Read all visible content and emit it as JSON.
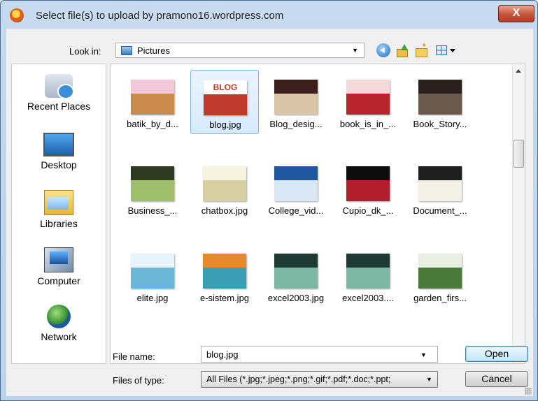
{
  "window": {
    "title": "Select file(s) to upload by pramono16.wordpress.com",
    "close_glyph": "X"
  },
  "lookin": {
    "label": "Look in:",
    "value": "Pictures"
  },
  "toolbar": {
    "icons": [
      "back-icon",
      "up-folder-icon",
      "new-folder-icon",
      "view-menu-icon"
    ]
  },
  "places": [
    {
      "label": "Recent Places",
      "icon": "recent-places-icon"
    },
    {
      "label": "Desktop",
      "icon": "desktop-icon"
    },
    {
      "label": "Libraries",
      "icon": "libraries-icon"
    },
    {
      "label": "Computer",
      "icon": "computer-icon"
    },
    {
      "label": "Network",
      "icon": "network-icon"
    }
  ],
  "files": [
    {
      "name": "batik_by_d...",
      "thumb_colors": [
        "#f3c9d9",
        "#c98a4a"
      ]
    },
    {
      "name": "blog.jpg",
      "thumb_text": "BLOG",
      "selected": true,
      "thumb_colors": [
        "#ffffff",
        "#c0392b"
      ]
    },
    {
      "name": "Blog_desig...",
      "thumb_colors": [
        "#3a1f1a",
        "#d9c4a8"
      ]
    },
    {
      "name": "book_is_in_...",
      "thumb_colors": [
        "#f4d9d9",
        "#b8242c"
      ]
    },
    {
      "name": "Book_Story...",
      "thumb_colors": [
        "#2a211c",
        "#6b5a4c"
      ]
    },
    {
      "name": "Business_...",
      "thumb_colors": [
        "#2f3a22",
        "#9fbf6a"
      ]
    },
    {
      "name": "chatbox.jpg",
      "thumb_colors": [
        "#f7f3de",
        "#d8cfa0"
      ]
    },
    {
      "name": "College_vid...",
      "thumb_colors": [
        "#1f57a0",
        "#d9e6f3"
      ]
    },
    {
      "name": "Cupio_dk_...",
      "thumb_colors": [
        "#0c0c0c",
        "#b21e2c"
      ]
    },
    {
      "name": "Document_...",
      "thumb_colors": [
        "#1e1e1e",
        "#f3f0e6"
      ]
    },
    {
      "name": "elite.jpg",
      "thumb_colors": [
        "#e6f4fb",
        "#6ab7d9"
      ]
    },
    {
      "name": "e-sistem.jpg",
      "thumb_colors": [
        "#e78a2f",
        "#3b9fb3"
      ]
    },
    {
      "name": "excel2003.jpg",
      "thumb_colors": [
        "#1e3a33",
        "#7cb8a3"
      ]
    },
    {
      "name": "excel2003....",
      "thumb_colors": [
        "#1e3a33",
        "#7cb8a3"
      ]
    },
    {
      "name": "garden_firs...",
      "thumb_colors": [
        "#e9efe3",
        "#4a7a3a"
      ]
    }
  ],
  "filename": {
    "label": "File name:",
    "value": "blog.jpg"
  },
  "filetype": {
    "label": "Files of type:",
    "value": "All Files (*.jpg;*.jpeg;*.png;*.gif;*.pdf;*.doc;*.ppt;"
  },
  "buttons": {
    "open": "Open",
    "cancel": "Cancel"
  }
}
